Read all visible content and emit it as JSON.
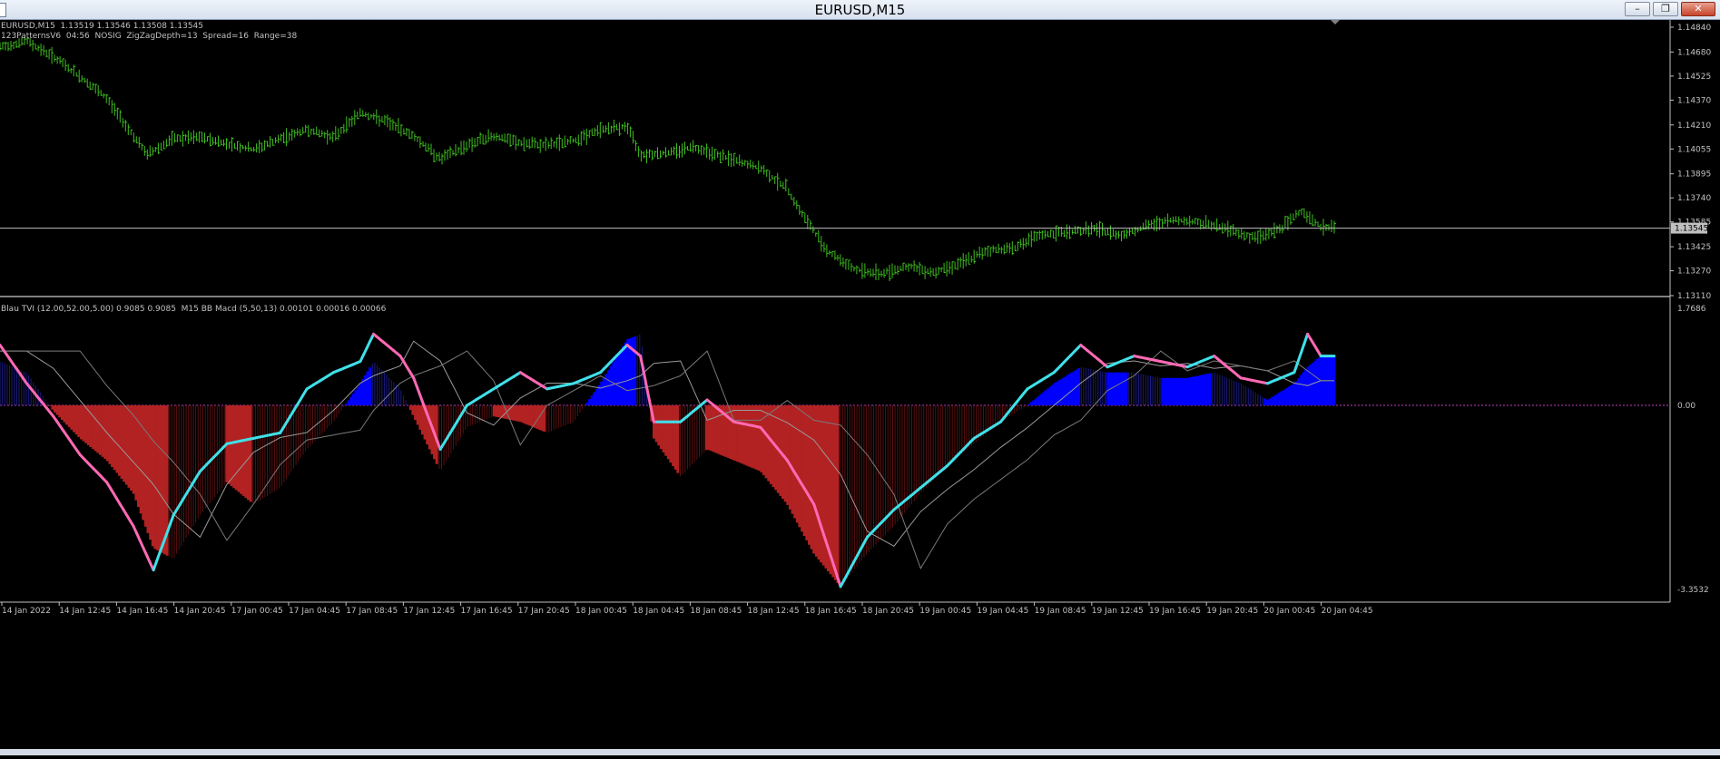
{
  "window": {
    "title": "EURUSD,M15",
    "minimize_icon": "minimize-icon",
    "restore_icon": "restore-icon",
    "close_icon": "close-icon"
  },
  "colors": {
    "background": "#000000",
    "bars": "#3fbf1f",
    "axis_text": "#c0c0c0",
    "red_histogram": "#b22222",
    "blue_histogram": "#0000ff",
    "tvi_up": "#40e0e8",
    "tvi_down": "#ff69b4",
    "bid_line": "#c0c0c0"
  },
  "main_panel": {
    "info_line1": "EURUSD,M15  1.13519 1.13546 1.13508 1.13545",
    "info_line2": "123PatternsV6  04:56  NOSIG  ZigZagDepth=13  Spread=16  Range=38",
    "price_labels": [
      "1.14840",
      "1.14680",
      "1.14525",
      "1.14370",
      "1.14210",
      "1.14055",
      "1.13895",
      "1.13740",
      "1.13585",
      "1.13425",
      "1.13270",
      "1.13110"
    ],
    "current_price": "1.13545"
  },
  "indicator_panel": {
    "info_line": "Blau TVI (12.00,52.00,5.00) 0.9085 0.9085  M15 BB Macd (5,50,13) 0.00101 0.00016 0.00066",
    "scale_labels": [
      "1.7686",
      "0.00",
      "-3.3532"
    ]
  },
  "time_axis": {
    "labels": [
      "14 Jan 2022",
      "14 Jan 12:45",
      "14 Jan 16:45",
      "14 Jan 20:45",
      "17 Jan 00:45",
      "17 Jan 04:45",
      "17 Jan 08:45",
      "17 Jan 12:45",
      "17 Jan 16:45",
      "17 Jan 20:45",
      "18 Jan 00:45",
      "18 Jan 04:45",
      "18 Jan 08:45",
      "18 Jan 12:45",
      "18 Jan 16:45",
      "18 Jan 20:45",
      "19 Jan 00:45",
      "19 Jan 04:45",
      "19 Jan 08:45",
      "19 Jan 12:45",
      "19 Jan 16:45",
      "19 Jan 20:45",
      "20 Jan 00:45",
      "20 Jan 04:45"
    ]
  },
  "chart_data": {
    "type": "line",
    "price_close_path": [
      [
        0,
        1.1471
      ],
      [
        0.02,
        1.1475
      ],
      [
        0.04,
        1.1465
      ],
      [
        0.06,
        1.1452
      ],
      [
        0.08,
        1.1438
      ],
      [
        0.095,
        1.142
      ],
      [
        0.11,
        1.1402
      ],
      [
        0.13,
        1.1412
      ],
      [
        0.15,
        1.1413
      ],
      [
        0.17,
        1.1409
      ],
      [
        0.19,
        1.1405
      ],
      [
        0.21,
        1.1412
      ],
      [
        0.23,
        1.1418
      ],
      [
        0.25,
        1.1413
      ],
      [
        0.27,
        1.1429
      ],
      [
        0.29,
        1.1423
      ],
      [
        0.31,
        1.1414
      ],
      [
        0.33,
        1.1399
      ],
      [
        0.35,
        1.1408
      ],
      [
        0.37,
        1.1414
      ],
      [
        0.39,
        1.1409
      ],
      [
        0.41,
        1.1408
      ],
      [
        0.43,
        1.1411
      ],
      [
        0.45,
        1.1418
      ],
      [
        0.47,
        1.142
      ],
      [
        0.48,
        1.1402
      ],
      [
        0.5,
        1.1403
      ],
      [
        0.52,
        1.1407
      ],
      [
        0.54,
        1.1401
      ],
      [
        0.57,
        1.1393
      ],
      [
        0.59,
        1.138
      ],
      [
        0.6,
        1.1365
      ],
      [
        0.62,
        1.134
      ],
      [
        0.64,
        1.1328
      ],
      [
        0.66,
        1.1325
      ],
      [
        0.68,
        1.133
      ],
      [
        0.7,
        1.1326
      ],
      [
        0.72,
        1.1332
      ],
      [
        0.74,
        1.134
      ],
      [
        0.76,
        1.1342
      ],
      [
        0.78,
        1.135
      ],
      [
        0.8,
        1.1352
      ],
      [
        0.82,
        1.1354
      ],
      [
        0.84,
        1.135
      ],
      [
        0.86,
        1.1356
      ],
      [
        0.88,
        1.136
      ],
      [
        0.9,
        1.1358
      ],
      [
        0.92,
        1.1354
      ],
      [
        0.94,
        1.1348
      ],
      [
        0.96,
        1.1354
      ],
      [
        0.975,
        1.1366
      ],
      [
        0.99,
        1.1355
      ]
    ],
    "tvi_path": [
      [
        0,
        1.1
      ],
      [
        0.02,
        0.4
      ],
      [
        0.04,
        -0.2
      ],
      [
        0.06,
        -0.9
      ],
      [
        0.08,
        -1.4
      ],
      [
        0.1,
        -2.2
      ],
      [
        0.115,
        -3.0
      ],
      [
        0.13,
        -2.0
      ],
      [
        0.15,
        -1.2
      ],
      [
        0.17,
        -0.7
      ],
      [
        0.19,
        -0.6
      ],
      [
        0.21,
        -0.5
      ],
      [
        0.23,
        0.3
      ],
      [
        0.25,
        0.6
      ],
      [
        0.27,
        0.8
      ],
      [
        0.28,
        1.3
      ],
      [
        0.3,
        0.9
      ],
      [
        0.31,
        0.5
      ],
      [
        0.33,
        -0.8
      ],
      [
        0.35,
        0.0
      ],
      [
        0.37,
        0.3
      ],
      [
        0.39,
        0.6
      ],
      [
        0.41,
        0.3
      ],
      [
        0.43,
        0.4
      ],
      [
        0.45,
        0.6
      ],
      [
        0.47,
        1.1
      ],
      [
        0.48,
        0.9
      ],
      [
        0.49,
        -0.3
      ],
      [
        0.51,
        -0.3
      ],
      [
        0.53,
        0.1
      ],
      [
        0.55,
        -0.3
      ],
      [
        0.57,
        -0.4
      ],
      [
        0.59,
        -1.0
      ],
      [
        0.61,
        -1.8
      ],
      [
        0.63,
        -3.3
      ],
      [
        0.65,
        -2.4
      ],
      [
        0.67,
        -1.9
      ],
      [
        0.69,
        -1.5
      ],
      [
        0.71,
        -1.1
      ],
      [
        0.73,
        -0.6
      ],
      [
        0.75,
        -0.3
      ],
      [
        0.77,
        0.3
      ],
      [
        0.79,
        0.6
      ],
      [
        0.81,
        1.1
      ],
      [
        0.83,
        0.7
      ],
      [
        0.85,
        0.9
      ],
      [
        0.87,
        0.8
      ],
      [
        0.89,
        0.7
      ],
      [
        0.91,
        0.9
      ],
      [
        0.93,
        0.5
      ],
      [
        0.95,
        0.4
      ],
      [
        0.97,
        0.6
      ],
      [
        0.98,
        1.3
      ],
      [
        0.99,
        0.9
      ]
    ],
    "histogram": [
      [
        0,
        0.8
      ],
      [
        0.02,
        0.6
      ],
      [
        0.04,
        -0.1
      ],
      [
        0.06,
        -0.6
      ],
      [
        0.08,
        -1.0
      ],
      [
        0.1,
        -1.6
      ],
      [
        0.115,
        -2.6
      ],
      [
        0.13,
        -2.8
      ],
      [
        0.15,
        -2.0
      ],
      [
        0.17,
        -1.4
      ],
      [
        0.19,
        -1.8
      ],
      [
        0.21,
        -1.5
      ],
      [
        0.23,
        -0.8
      ],
      [
        0.25,
        -0.3
      ],
      [
        0.27,
        0.4
      ],
      [
        0.28,
        0.8
      ],
      [
        0.3,
        0.3
      ],
      [
        0.31,
        -0.2
      ],
      [
        0.33,
        -1.2
      ],
      [
        0.35,
        -0.4
      ],
      [
        0.37,
        -0.2
      ],
      [
        0.39,
        -0.3
      ],
      [
        0.41,
        -0.5
      ],
      [
        0.43,
        -0.3
      ],
      [
        0.45,
        0.4
      ],
      [
        0.47,
        1.2
      ],
      [
        0.48,
        1.3
      ],
      [
        0.49,
        -0.6
      ],
      [
        0.51,
        -1.3
      ],
      [
        0.53,
        -0.8
      ],
      [
        0.55,
        -1.0
      ],
      [
        0.57,
        -1.2
      ],
      [
        0.59,
        -1.8
      ],
      [
        0.61,
        -2.7
      ],
      [
        0.63,
        -3.3
      ],
      [
        0.65,
        -2.7
      ],
      [
        0.67,
        -2.2
      ],
      [
        0.69,
        -1.6
      ],
      [
        0.71,
        -1.1
      ],
      [
        0.73,
        -0.7
      ],
      [
        0.75,
        -0.3
      ],
      [
        0.77,
        0.0
      ],
      [
        0.79,
        0.4
      ],
      [
        0.81,
        0.7
      ],
      [
        0.83,
        0.6
      ],
      [
        0.85,
        0.6
      ],
      [
        0.87,
        0.5
      ],
      [
        0.89,
        0.5
      ],
      [
        0.91,
        0.6
      ],
      [
        0.93,
        0.4
      ],
      [
        0.95,
        0.1
      ],
      [
        0.97,
        0.4
      ],
      [
        0.98,
        0.7
      ],
      [
        0.99,
        0.9
      ]
    ]
  }
}
